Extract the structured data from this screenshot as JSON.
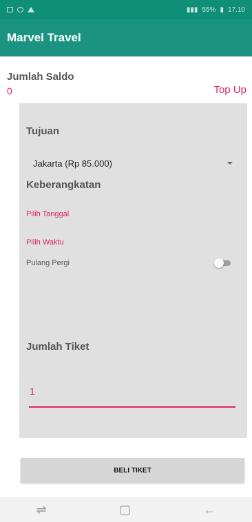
{
  "status_bar": {
    "left_icons": [
      "image-icon",
      "clock-icon",
      "warning-icon"
    ],
    "right_text": "55%",
    "time": "17.10"
  },
  "app_bar": {
    "title": "Marvel Travel"
  },
  "balance": {
    "label": "Jumlah Saldo",
    "value": "0",
    "topup_label": "Top Up"
  },
  "form": {
    "destination_title": "Tujuan",
    "destination_value": "Jakarta (Rp 85.000)",
    "departure_title": "Keberangkatan",
    "pick_date": "Pilih Tanggal",
    "pick_time": "Pilih Waktu",
    "round_trip_label": "Pulang Pergi",
    "round_trip_on": false,
    "ticket_title": "Jumlah Tiket",
    "ticket_value": "1"
  },
  "buy_button_label": "BELI TIKET",
  "nav": {
    "icons": [
      "recents-icon",
      "home-icon",
      "back-icon"
    ]
  },
  "colors": {
    "primary": "#1a9480",
    "accent": "#e0245e",
    "card": "#e0e0e0"
  }
}
